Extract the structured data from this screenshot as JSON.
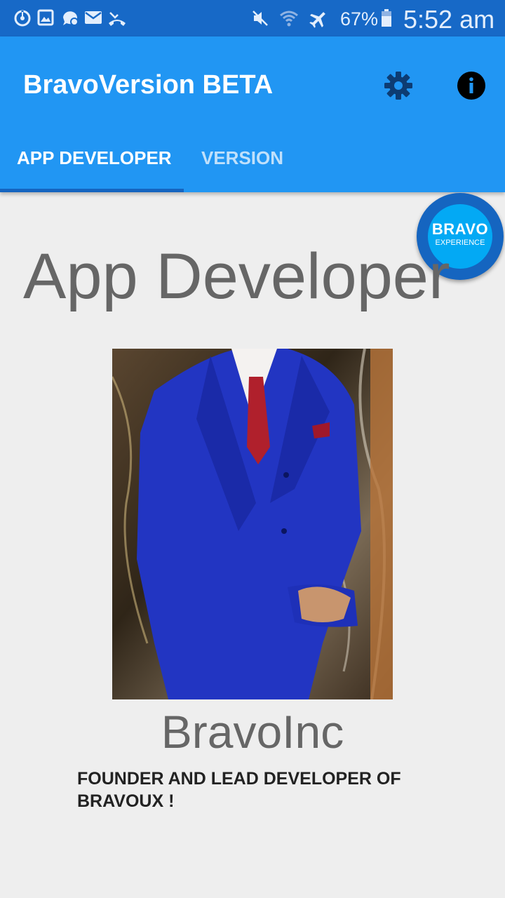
{
  "status_bar": {
    "battery": "67%",
    "time": "5:52 am"
  },
  "app_bar": {
    "title": "BravoVersion BETA"
  },
  "tabs": [
    {
      "label": "APP DEVELOPER"
    },
    {
      "label": "VERSION"
    }
  ],
  "fab": {
    "title": "BRAVO",
    "subtitle": "EXPERIENCE"
  },
  "content": {
    "heading": "App Developer",
    "name": "BravoInc",
    "description": "FOUNDER AND LEAD DEVELOPER OF BRAVOUX !"
  },
  "colors": {
    "status_bar": "#1769c7",
    "app_bar": "#2196f3",
    "tab_indicator": "#1565c0",
    "background": "#eeeeee"
  },
  "icons": {
    "status_left": [
      "sync-icon",
      "image-icon",
      "chat-icon",
      "mail-icon",
      "missed-call-icon"
    ],
    "status_right": [
      "mute-icon",
      "wifi-icon",
      "airplane-icon",
      "battery-icon"
    ],
    "toolbar": [
      "gear-icon",
      "info-icon"
    ]
  }
}
